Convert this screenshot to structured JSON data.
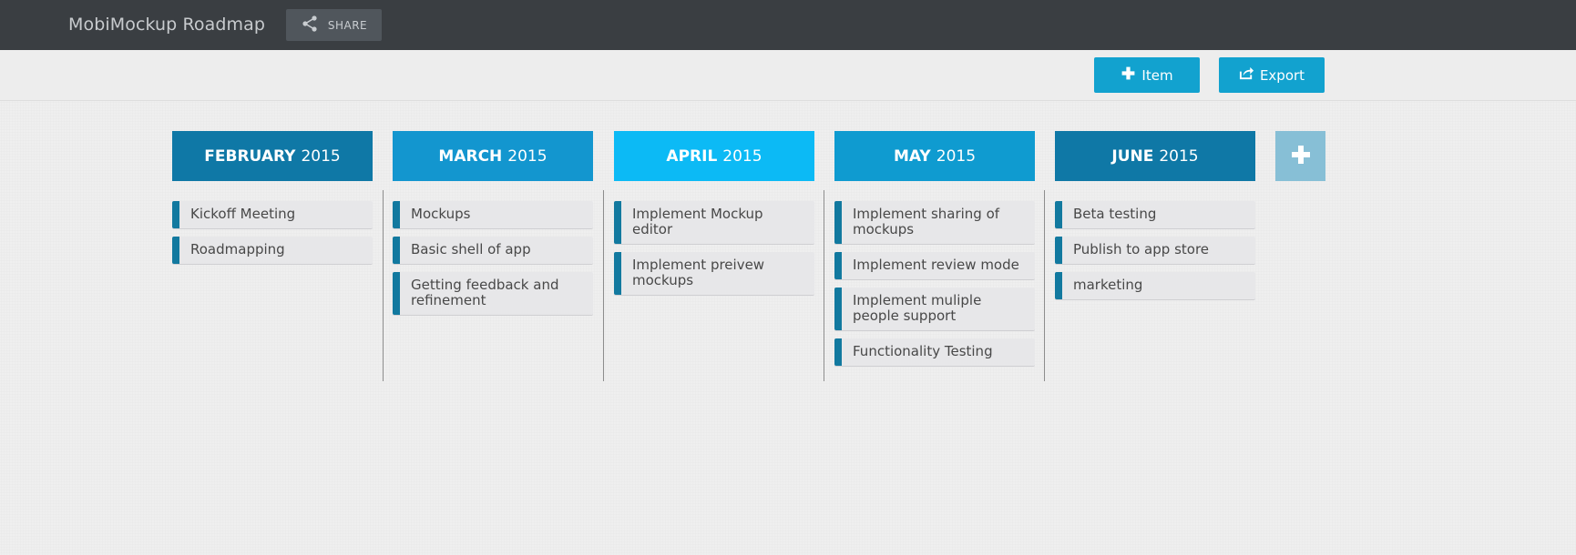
{
  "app": {
    "title": "MobiMockup Roadmap",
    "share_label": "SHARE"
  },
  "toolbar": {
    "item_label": "Item",
    "export_label": "Export"
  },
  "colors": {
    "accent": "#12a2cf",
    "card_marker": "#12799f"
  },
  "months": [
    {
      "name": "FEBRUARY",
      "year": "2015",
      "color": "#0f78a6",
      "items": [
        "Kickoff Meeting",
        "Roadmapping"
      ]
    },
    {
      "name": "MARCH",
      "year": "2015",
      "color": "#1396cf",
      "items": [
        "Mockups",
        "Basic shell of app",
        "Getting feedback and refinement"
      ]
    },
    {
      "name": "APRIL",
      "year": "2015",
      "color": "#0cbaf5",
      "items": [
        "Implement Mockup editor",
        "Implement preivew mockups"
      ]
    },
    {
      "name": "MAY",
      "year": "2015",
      "color": "#0f9bd0",
      "items": [
        "Implement sharing of mockups",
        "Implement review mode",
        "Implement muliple people support",
        "Functionality Testing"
      ]
    },
    {
      "name": "JUNE",
      "year": "2015",
      "color": "#0f78a6",
      "items": [
        "Beta testing",
        "Publish to app store",
        "marketing"
      ]
    }
  ]
}
